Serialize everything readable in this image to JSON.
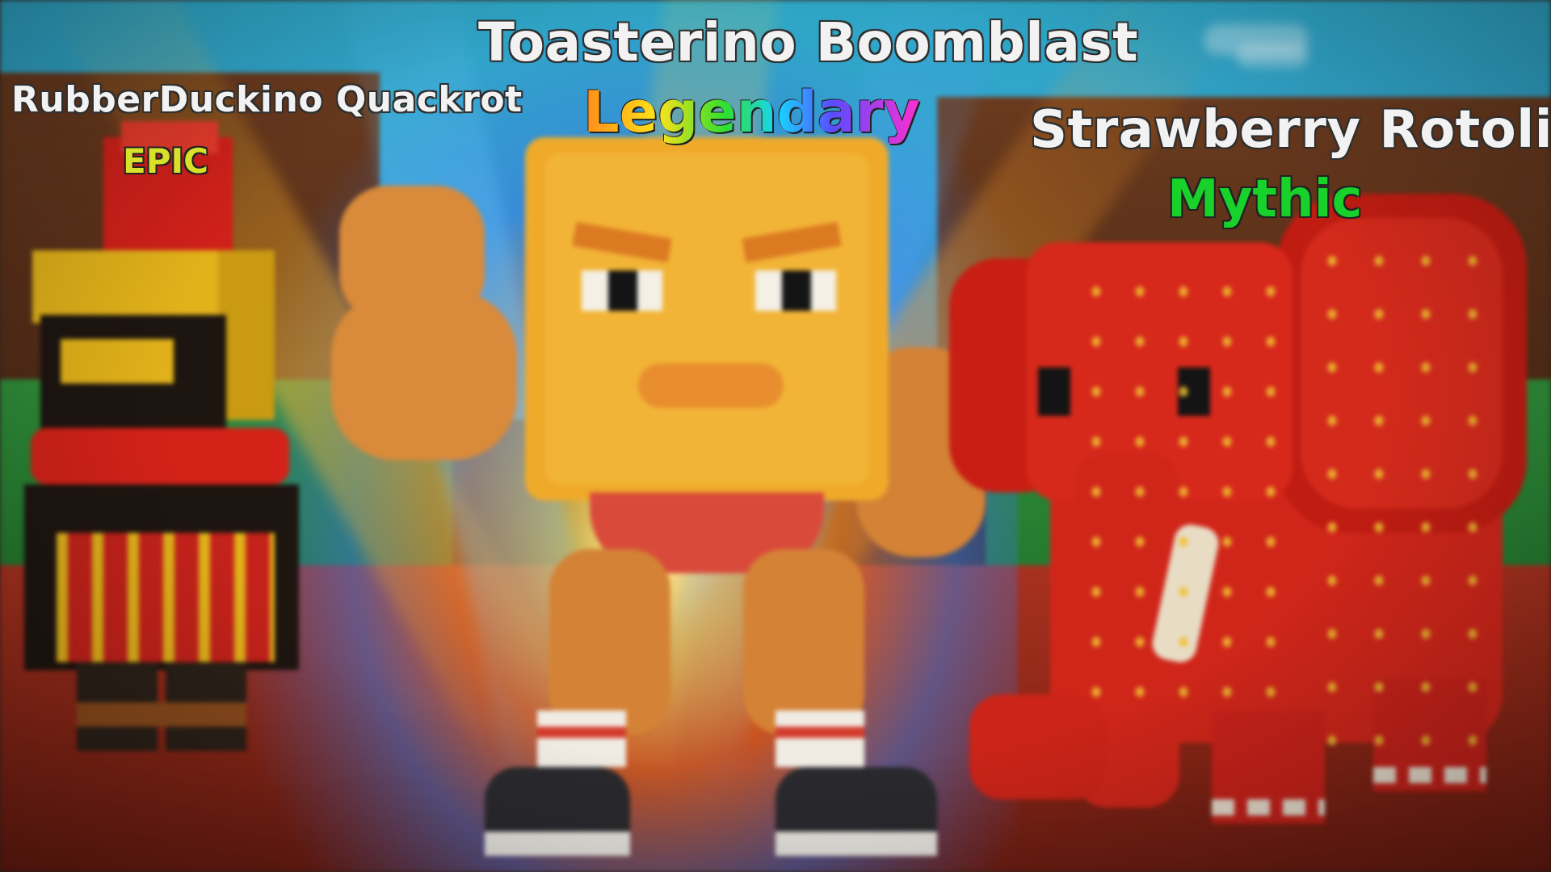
{
  "scene": {
    "characters": [
      {
        "id": "left",
        "name": "RubberDuckino Quackrot",
        "rarity": "EPIC",
        "rarity_color": "#d8e02a"
      },
      {
        "id": "center",
        "name": "Toasterino Boomblast",
        "rarity": "Legendary",
        "rarity_color": "rainbow"
      },
      {
        "id": "right",
        "name": "Strawberry Rotolini",
        "rarity": "Mythic",
        "rarity_color": "#18d12a"
      }
    ]
  },
  "colors": {
    "sky": "#33a3cf",
    "wall": "#5a3119",
    "grass": "#2a8a35",
    "floor": "#9a2b1a"
  }
}
